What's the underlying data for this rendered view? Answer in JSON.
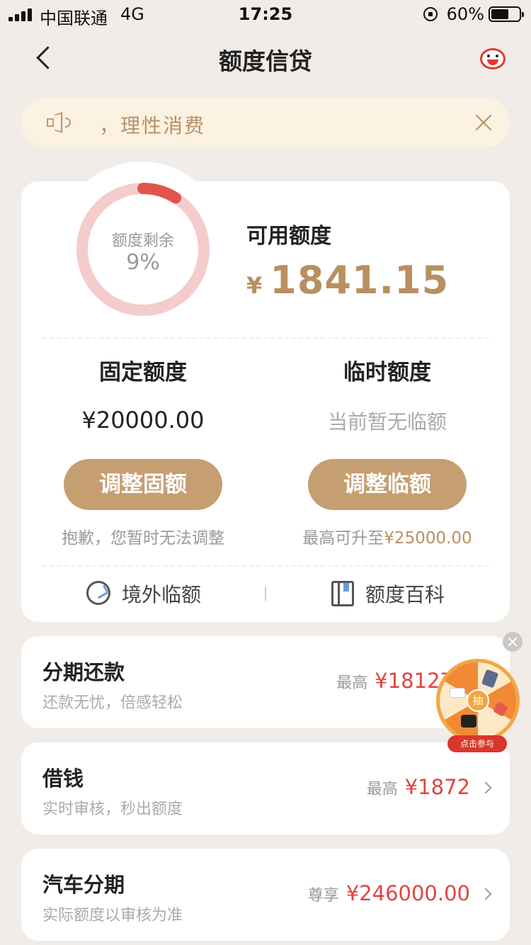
{
  "status_bar": {
    "carrier": "中国联通",
    "network": "4G",
    "time": "17:25",
    "battery_percent": "60%",
    "battery_level": 0.6
  },
  "nav": {
    "title": "额度信贷",
    "back_icon": "chevron-left-icon",
    "mascot_icon": "mascot-icon"
  },
  "notice": {
    "text": "，理性消费",
    "speaker_icon": "speaker-icon",
    "close_icon": "close-icon"
  },
  "credit": {
    "ring_label": "额度剩余",
    "ring_percent": "9%",
    "ring_value": 0.09,
    "ring_color": "#e0544c",
    "ring_track_color": "#f5cccc",
    "available_label": "可用额度",
    "available_currency": "¥",
    "available_amount": "1841.15",
    "fixed": {
      "title": "固定额度",
      "value": "¥20000.00",
      "button": "调整固额",
      "note": "抱歉，您暂时无法调整"
    },
    "temp": {
      "title": "临时额度",
      "value": "当前暂无临额",
      "button": "调整临额",
      "note_prefix": "最高可升至",
      "note_amount": "¥25000.00"
    },
    "tools": {
      "left_label": "境外临额",
      "right_label": "额度百科"
    }
  },
  "products": [
    {
      "title": "分期还款",
      "subtitle": "还款无忧，倍感轻松",
      "prefix": "最高",
      "amount": "¥18127"
    },
    {
      "title": "借钱",
      "subtitle": "实时审核，秒出额度",
      "prefix": "最高",
      "amount": "¥1872"
    },
    {
      "title": "汽车分期",
      "subtitle": "实际额度以审核为准",
      "prefix": "尊享",
      "amount": "¥246000.00"
    }
  ],
  "wheel": {
    "hub_label": "抽",
    "banner": "点击参与"
  },
  "colors": {
    "accent_gold": "#c59f72",
    "amount_red": "#e0453d",
    "background": "#f1ece8"
  }
}
